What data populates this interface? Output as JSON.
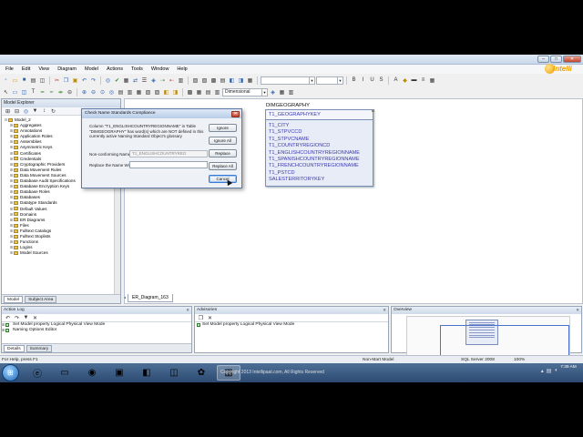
{
  "menu": [
    "File",
    "Edit",
    "View",
    "Diagram",
    "Model",
    "Actions",
    "Tools",
    "Window",
    "Help"
  ],
  "toolbar": {
    "view_mode_value": "Dimensional"
  },
  "logo": {
    "text": "Intelli"
  },
  "model_explorer": {
    "title": "Model Explorer",
    "root": "Model_2",
    "items": [
      "Aggregates",
      "Annotations",
      "Application Roles",
      "Assemblies",
      "Asymmetric Keys",
      "Certificates",
      "Credentials",
      "Cryptographic Providers",
      "Data Movement Rules",
      "Data Movement Sources",
      "Database Audit Specifications",
      "Database Encryption Keys",
      "Database Roles",
      "Databases",
      "Datatype Standards",
      "Default Values",
      "Domains",
      "ER Diagrams",
      "Files",
      "Fulltext Catalogs",
      "Fulltext Stoplists",
      "Functions",
      "Logins",
      "Model Sources"
    ],
    "tabs": [
      "Model",
      "Subject Area"
    ]
  },
  "diagram": {
    "tab_label": "ER_Diagram_163",
    "entity": {
      "name": "DIMGEOGRAPHY",
      "primary_key": "T1_GEOGRAPHYKEY",
      "attributes": [
        "T1_CITY",
        "T1_STPVCCD",
        "T1_STPVCNAME",
        "T1_COUNTRYREGIONCD",
        "T1_ENGLISHCOUNTRYREGIONNAME",
        "T1_SPANISHCOUNTRYREGIONNAME",
        "T1_FRENCHCOUNTRYREGIONNAME",
        "T1_PSTCD",
        "SALESTERRITORYKEY"
      ]
    }
  },
  "dialog": {
    "title": "Check Name Standards Compliance",
    "message": "Column \"T1_ENGLISHCOUNTRYREGIONNAME\" in Table \"DIMGEOGRAPHY\" has word(s) which are NOT defined in this currently active Naming Standard Object's glossary",
    "nonconforming_label": "Non-conforming Name:",
    "nonconforming_value": "T1_ENGLISHCOUNTRYREG",
    "replace_label": "Replace the Name With:",
    "replace_value": "",
    "buttons": {
      "ignore": "Ignore",
      "ignore_all": "Ignore All",
      "replace": "Replace",
      "replace_all": "Replace All",
      "cancel": "Cancel"
    }
  },
  "action_log": {
    "title": "Action Log",
    "rows": [
      "Set Model property Logical Physical View Mode",
      "Naming Options Editor"
    ],
    "tabs": [
      "Details",
      "Summary"
    ]
  },
  "advisories": {
    "title": "Advisories",
    "rows": [
      "Set Model property Logical Physical View Mode"
    ]
  },
  "overview": {
    "title": "Overview"
  },
  "status": {
    "help": "For Help, press F1",
    "model_type": "Non-Mart Model",
    "db": "SQL Server 2008",
    "zoom": "100%"
  },
  "taskbar": {
    "time": "7:39 AM"
  },
  "copyright": "Copyright 2013 Intellipaat.com, All Rights Reserved"
}
